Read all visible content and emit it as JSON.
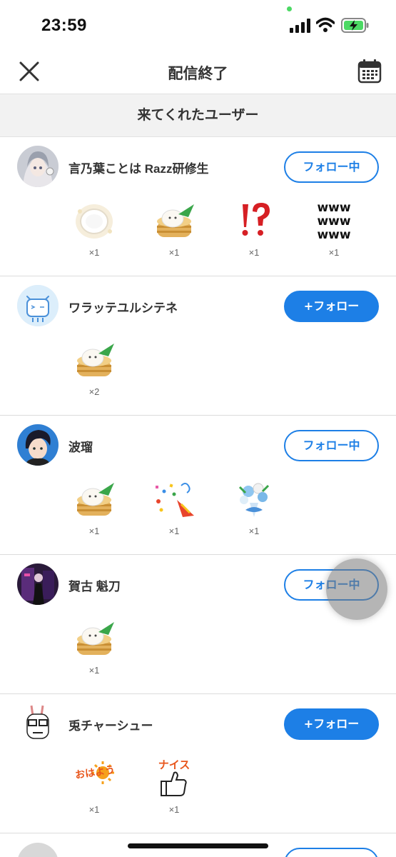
{
  "status_bar": {
    "time": "23:59"
  },
  "nav": {
    "title": "配信終了",
    "close_icon": "close-icon",
    "calendar_icon": "calendar-icon"
  },
  "section": {
    "title": "来てくれたユーザー"
  },
  "colors": {
    "accent": "#1d7fe6",
    "divider": "#dcdcdc",
    "section_bg": "#f2f2f2"
  },
  "users": [
    {
      "name": "言乃葉ことは Razz研修生",
      "button": "フォロー中",
      "following": true,
      "gifts": [
        {
          "icon": "plate-gift-icon",
          "count": "×1"
        },
        {
          "icon": "steamed-bun-gift-icon",
          "count": "×1"
        },
        {
          "icon": "exclamation-question-gift-icon",
          "count": "×1"
        },
        {
          "icon": "www-gift-icon",
          "count": "×1"
        }
      ]
    },
    {
      "name": "ワラッテユルシテネ",
      "button": "+フォロー",
      "following": false,
      "gifts": [
        {
          "icon": "steamed-bun-gift-icon",
          "count": "×2"
        }
      ]
    },
    {
      "name": "波瑠",
      "button": "フォロー中",
      "following": true,
      "gifts": [
        {
          "icon": "steamed-bun-gift-icon",
          "count": "×1"
        },
        {
          "icon": "party-popper-gift-icon",
          "count": "×1"
        },
        {
          "icon": "bouquet-gift-icon",
          "count": "×1"
        }
      ]
    },
    {
      "name": "賀古 魁刀",
      "button": "フォロー中",
      "following": true,
      "gifts": [
        {
          "icon": "steamed-bun-gift-icon",
          "count": "×1"
        }
      ]
    },
    {
      "name": "兎チャーシュー",
      "button": "+フォロー",
      "following": false,
      "gifts": [
        {
          "icon": "ohayou-gift-icon",
          "count": "×1"
        },
        {
          "icon": "nice-thumbs-up-gift-icon",
          "count": "×1"
        }
      ]
    }
  ],
  "gift_texts": {
    "www_line": "www",
    "ohayou": "おはよう",
    "nice": "ナイス"
  }
}
